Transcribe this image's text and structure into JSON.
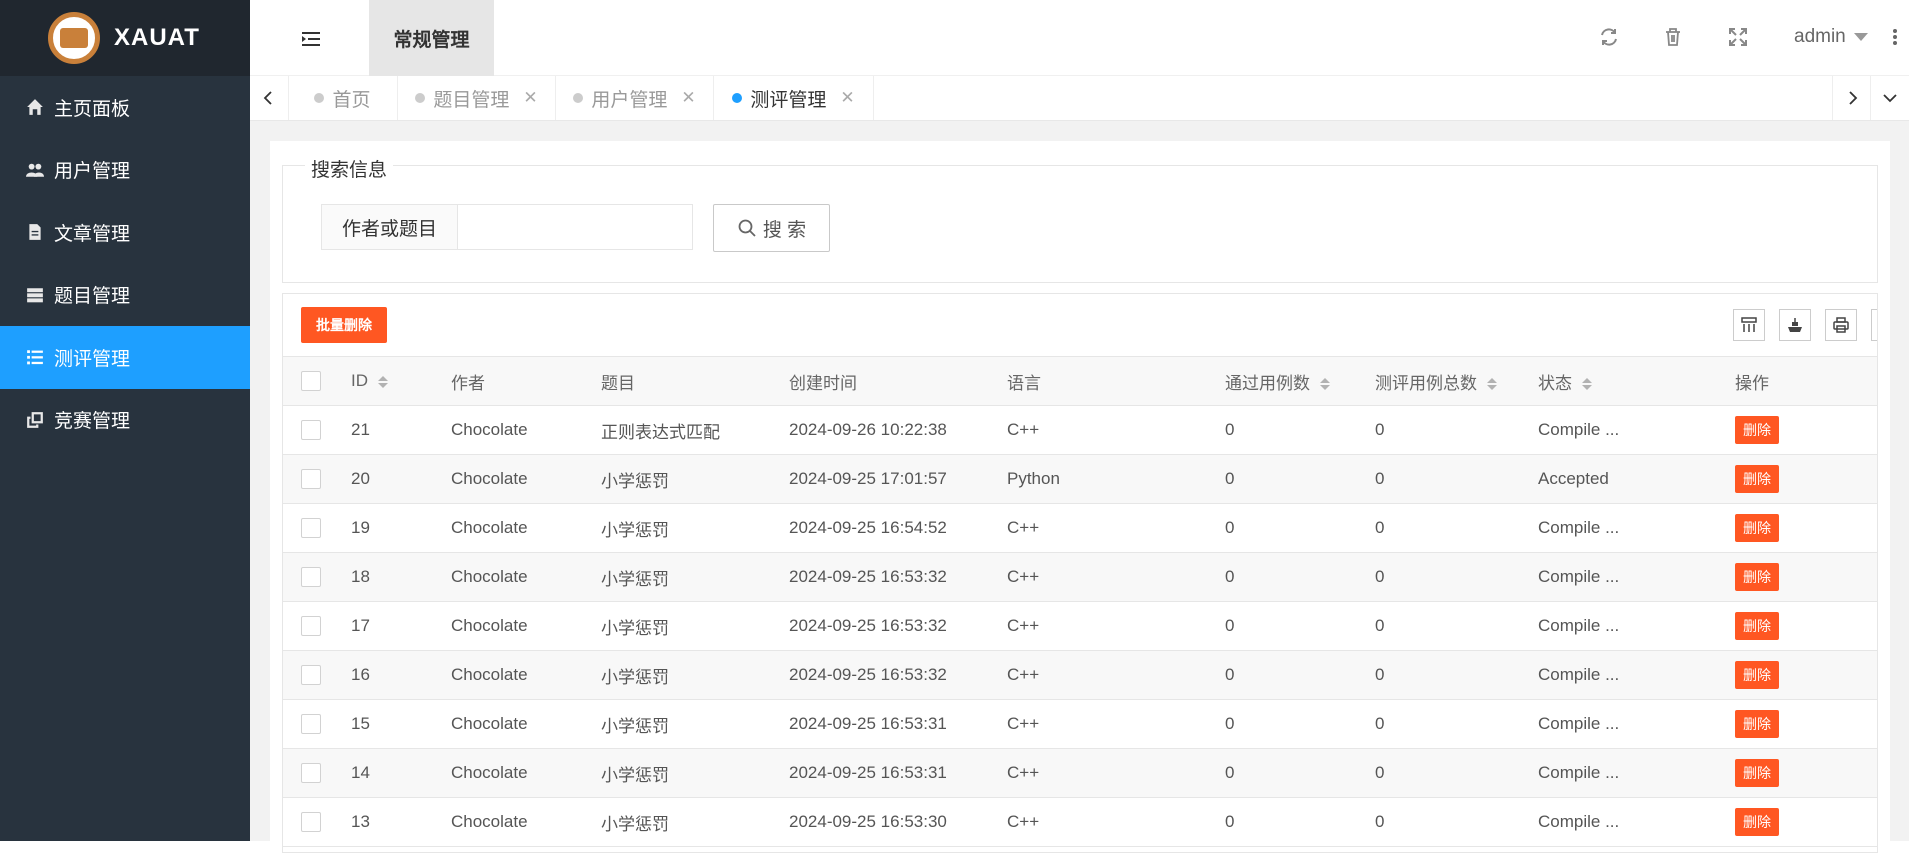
{
  "app": {
    "logo_text": "XAUAT"
  },
  "sidebar": {
    "items": [
      {
        "label": "主页面板",
        "icon": "home-icon",
        "active": false
      },
      {
        "label": "用户管理",
        "icon": "users-icon",
        "active": false
      },
      {
        "label": "文章管理",
        "icon": "file-icon",
        "active": false
      },
      {
        "label": "题目管理",
        "icon": "server-icon",
        "active": false
      },
      {
        "label": "测评管理",
        "icon": "list-icon",
        "active": true
      },
      {
        "label": "竞赛管理",
        "icon": "clone-icon",
        "active": false
      }
    ]
  },
  "header": {
    "nav_label": "常规管理",
    "user": "admin",
    "tools": [
      "refresh-icon",
      "trash-icon",
      "fullscreen-icon",
      "more-icon"
    ]
  },
  "tabs": [
    {
      "label": "首页",
      "closable": false,
      "active": false
    },
    {
      "label": "题目管理",
      "closable": true,
      "active": false
    },
    {
      "label": "用户管理",
      "closable": true,
      "active": false
    },
    {
      "label": "测评管理",
      "closable": true,
      "active": true
    }
  ],
  "search": {
    "legend": "搜索信息",
    "label": "作者或题目",
    "value": "",
    "button": "搜 索"
  },
  "table": {
    "batch_delete": "批量删除",
    "columns": [
      "ID",
      "作者",
      "题目",
      "创建时间",
      "语言",
      "通过用例数",
      "测评用例总数",
      "状态",
      "操作"
    ],
    "delete_label": "删除",
    "rows": [
      {
        "id": "21",
        "author": "Chocolate",
        "problem": "正则表达式匹配",
        "created": "2024-09-26 10:22:38",
        "lang": "C++",
        "passed": "0",
        "total": "0",
        "status": "Compile ..."
      },
      {
        "id": "20",
        "author": "Chocolate",
        "problem": "小学惩罚",
        "created": "2024-09-25 17:01:57",
        "lang": "Python",
        "passed": "0",
        "total": "0",
        "status": "Accepted"
      },
      {
        "id": "19",
        "author": "Chocolate",
        "problem": "小学惩罚",
        "created": "2024-09-25 16:54:52",
        "lang": "C++",
        "passed": "0",
        "total": "0",
        "status": "Compile ..."
      },
      {
        "id": "18",
        "author": "Chocolate",
        "problem": "小学惩罚",
        "created": "2024-09-25 16:53:32",
        "lang": "C++",
        "passed": "0",
        "total": "0",
        "status": "Compile ..."
      },
      {
        "id": "17",
        "author": "Chocolate",
        "problem": "小学惩罚",
        "created": "2024-09-25 16:53:32",
        "lang": "C++",
        "passed": "0",
        "total": "0",
        "status": "Compile ..."
      },
      {
        "id": "16",
        "author": "Chocolate",
        "problem": "小学惩罚",
        "created": "2024-09-25 16:53:32",
        "lang": "C++",
        "passed": "0",
        "total": "0",
        "status": "Compile ..."
      },
      {
        "id": "15",
        "author": "Chocolate",
        "problem": "小学惩罚",
        "created": "2024-09-25 16:53:31",
        "lang": "C++",
        "passed": "0",
        "total": "0",
        "status": "Compile ..."
      },
      {
        "id": "14",
        "author": "Chocolate",
        "problem": "小学惩罚",
        "created": "2024-09-25 16:53:31",
        "lang": "C++",
        "passed": "0",
        "total": "0",
        "status": "Compile ..."
      },
      {
        "id": "13",
        "author": "Chocolate",
        "problem": "小学惩罚",
        "created": "2024-09-25 16:53:30",
        "lang": "C++",
        "passed": "0",
        "total": "0",
        "status": "Compile ..."
      }
    ]
  }
}
